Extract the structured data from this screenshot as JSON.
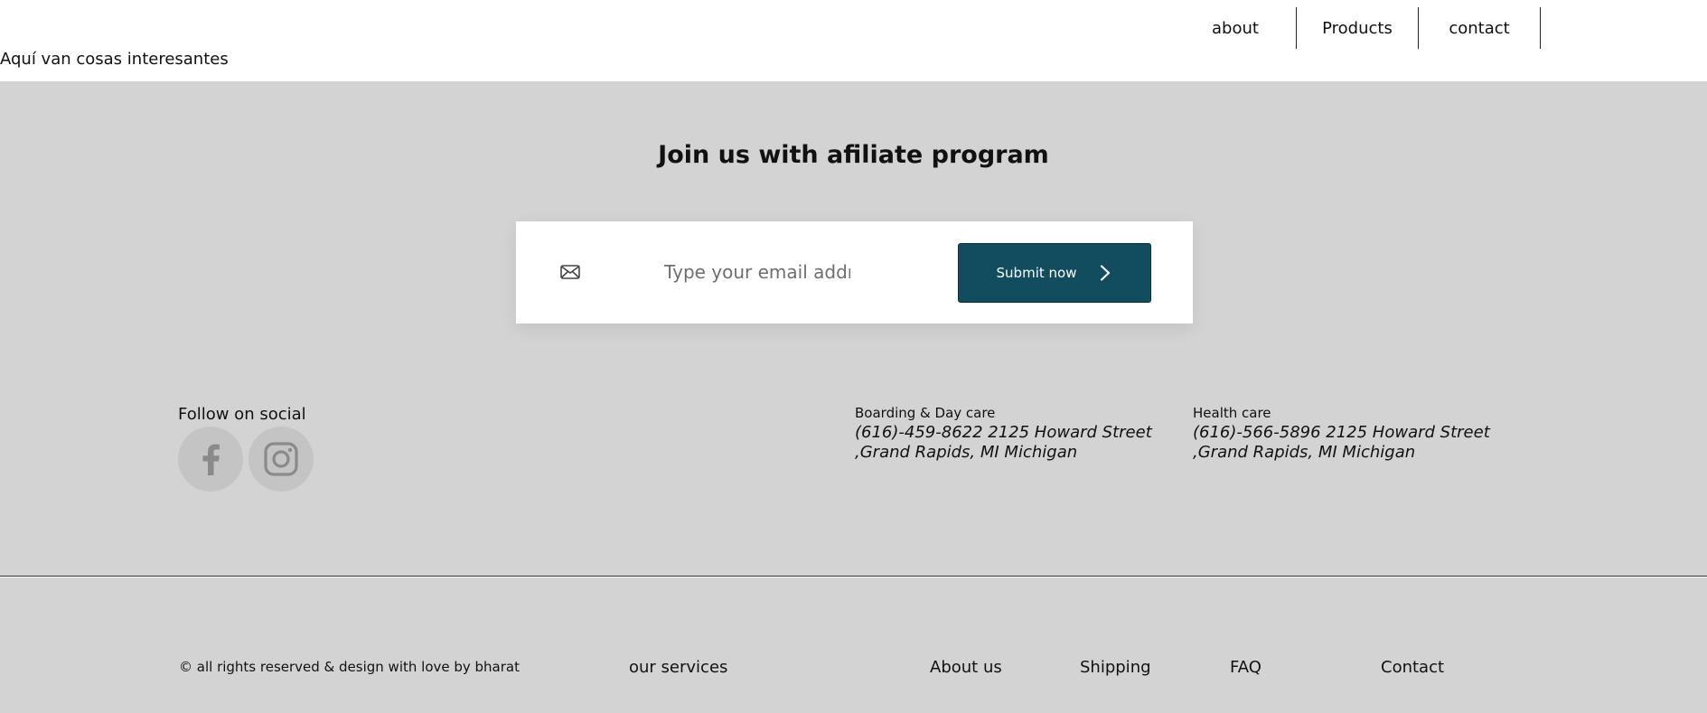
{
  "header": {
    "tagline": "Aquí van cosas interesantes",
    "nav": [
      {
        "label": "about"
      },
      {
        "label": "Products"
      },
      {
        "label": "contact"
      }
    ]
  },
  "affiliate": {
    "title": "Join us with afiliate program",
    "email_placeholder": "Type your email address",
    "email_value": "",
    "submit_label": "Submit now"
  },
  "social": {
    "title": "Follow on social",
    "icons": [
      "facebook-icon",
      "instagram-icon"
    ]
  },
  "contacts": [
    {
      "heading": "Boarding & Day care",
      "line1": "(616)-459-8622 2125 Howard Street",
      "line2": ",Grand Rapids, MI Michigan"
    },
    {
      "heading": "Health care",
      "line1": "(616)-566-5896 2125 Howard Street",
      "line2": ",Grand Rapids, MI Michigan"
    }
  ],
  "footer": {
    "copyright": "© all rights reserved & design with love by bharat",
    "links": [
      {
        "label": "our services"
      },
      {
        "label": "About us"
      },
      {
        "label": "Shipping"
      },
      {
        "label": "FAQ"
      },
      {
        "label": "Contact"
      }
    ]
  },
  "colors": {
    "background_gray": "#d3d3d3",
    "button": "#124c5f",
    "text": "#111111"
  }
}
